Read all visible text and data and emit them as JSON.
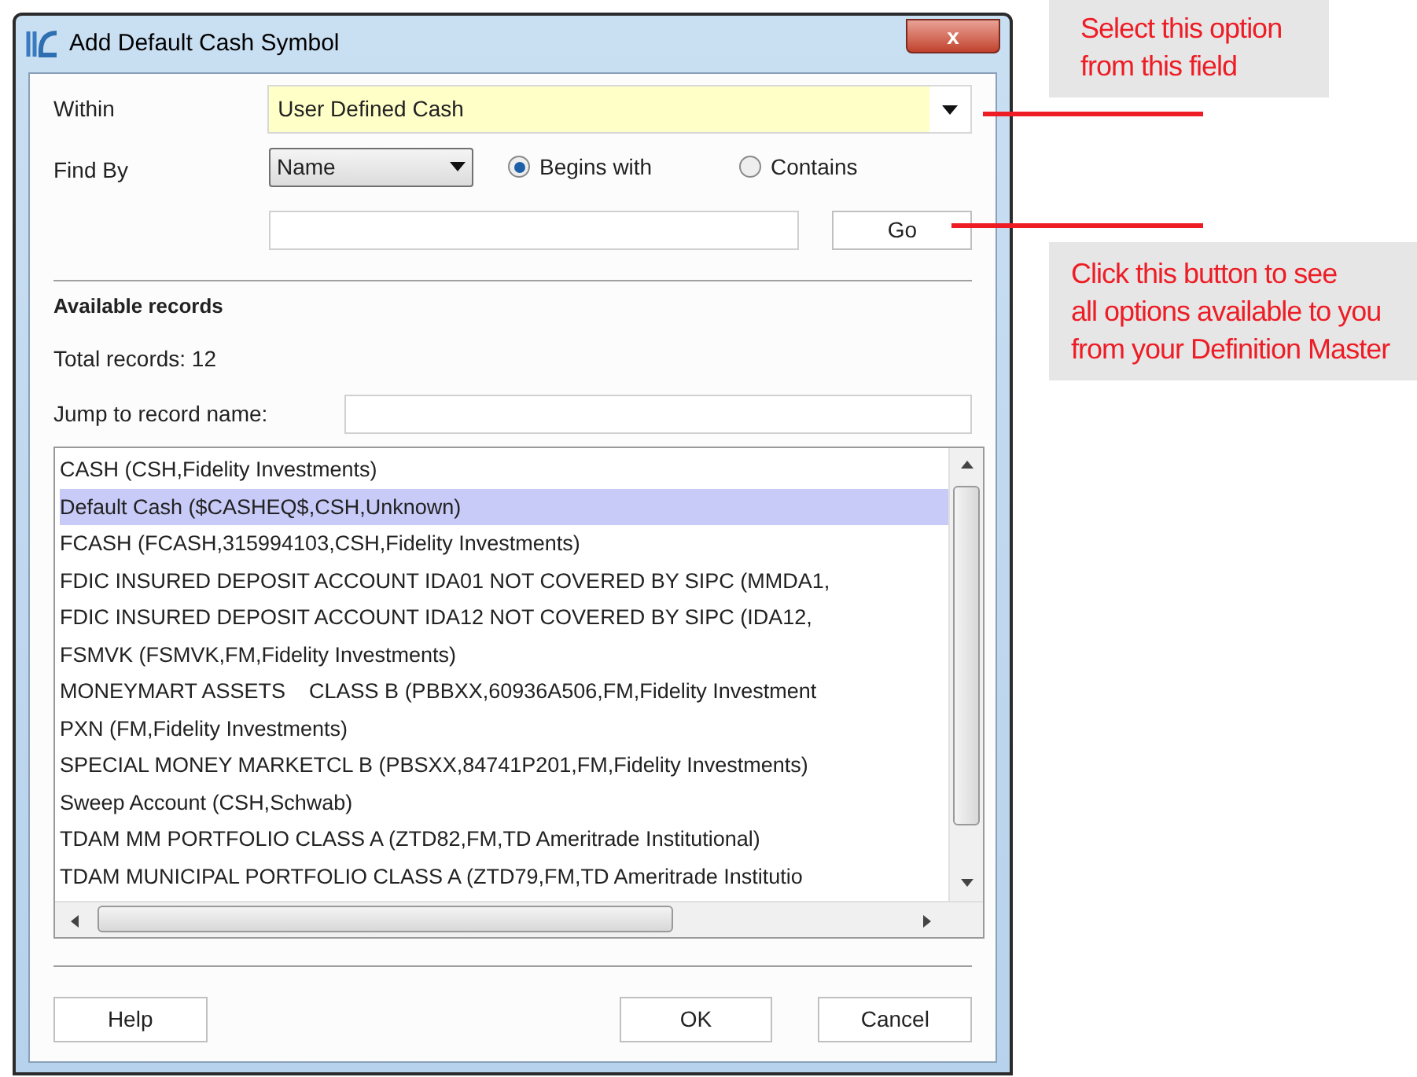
{
  "window": {
    "title": "Add Default Cash Symbol",
    "close": "x"
  },
  "within": {
    "label": "Within",
    "value": "User Defined Cash"
  },
  "find_by": {
    "label": "Find By",
    "value": "Name",
    "options": [
      {
        "label": "Begins with",
        "selected": true
      },
      {
        "label": "Contains",
        "selected": false
      }
    ],
    "search_button": "Go"
  },
  "available_records": {
    "heading": "Available records",
    "total": "Total records: 12",
    "jump_label": "Jump to record name:"
  },
  "records": [
    {
      "text": "CASH (CSH,Fidelity Investments)",
      "selected": false
    },
    {
      "text": "Default Cash ($CASHEQ$,CSH,Unknown)",
      "selected": true
    },
    {
      "text": "FCASH (FCASH,315994103,CSH,Fidelity Investments)",
      "selected": false
    },
    {
      "text": "FDIC INSURED DEPOSIT ACCOUNT IDA01 NOT COVERED BY SIPC (MMDA1,",
      "selected": false
    },
    {
      "text": "FDIC INSURED DEPOSIT ACCOUNT IDA12 NOT COVERED BY SIPC (IDA12,",
      "selected": false
    },
    {
      "text": "FSMVK (FSMVK,FM,Fidelity Investments)",
      "selected": false
    },
    {
      "text": "MONEYMART ASSETS    CLASS B (PBBXX,60936A506,FM,Fidelity Investment",
      "selected": false
    },
    {
      "text": "PXN (FM,Fidelity Investments)",
      "selected": false
    },
    {
      "text": "SPECIAL MONEY MARKETCL B (PBSXX,84741P201,FM,Fidelity Investments)",
      "selected": false
    },
    {
      "text": "Sweep Account (CSH,Schwab)",
      "selected": false
    },
    {
      "text": "TDAM MM PORTFOLIO CLASS A (ZTD82,FM,TD Ameritrade Institutional)",
      "selected": false
    },
    {
      "text": "TDAM MUNICIPAL PORTFOLIO CLASS A (ZTD79,FM,TD Ameritrade Institutio",
      "selected": false
    }
  ],
  "buttons": [
    "Help",
    "OK",
    "Cancel"
  ],
  "callouts": [
    {
      "lines": [
        "Select this option",
        "from this field"
      ]
    },
    {
      "lines": [
        "Click this button to see",
        "all options available to you",
        "from your Definition Master"
      ]
    }
  ]
}
